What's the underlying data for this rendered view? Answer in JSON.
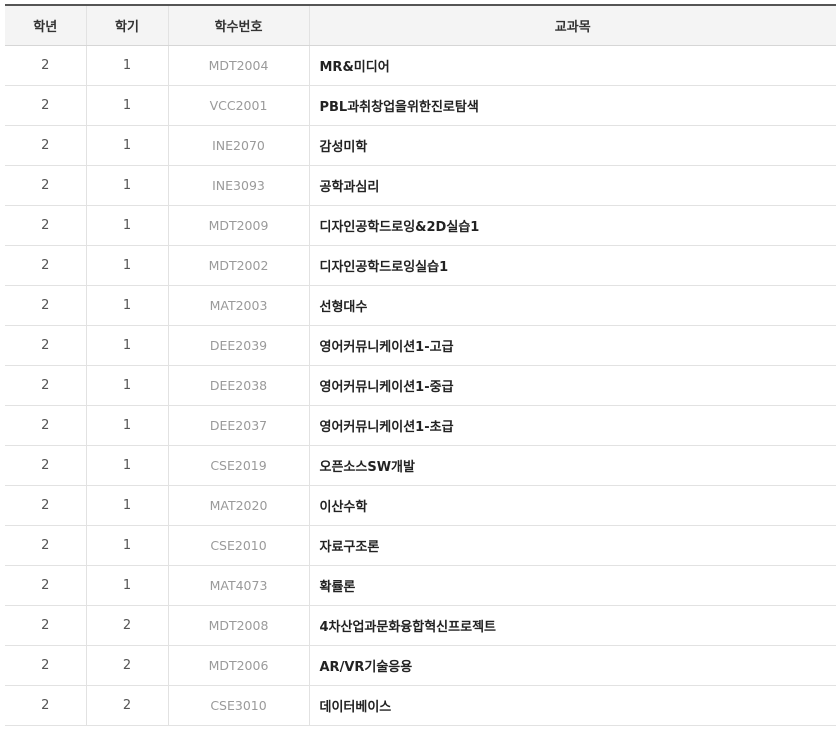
{
  "table": {
    "headers": [
      "학년",
      "학기",
      "학수번호",
      "교과목"
    ],
    "rows": [
      {
        "year": "2",
        "semester": "1",
        "code": "MDT2004",
        "course": "MR&미디어"
      },
      {
        "year": "2",
        "semester": "1",
        "code": "VCC2001",
        "course": "PBL과취창업을위한진로탐색"
      },
      {
        "year": "2",
        "semester": "1",
        "code": "INE2070",
        "course": "감성미학"
      },
      {
        "year": "2",
        "semester": "1",
        "code": "INE3093",
        "course": "공학과심리"
      },
      {
        "year": "2",
        "semester": "1",
        "code": "MDT2009",
        "course": "디자인공학드로잉&2D실습1"
      },
      {
        "year": "2",
        "semester": "1",
        "code": "MDT2002",
        "course": "디자인공학드로잉실습1"
      },
      {
        "year": "2",
        "semester": "1",
        "code": "MAT2003",
        "course": "선형대수"
      },
      {
        "year": "2",
        "semester": "1",
        "code": "DEE2039",
        "course": "영어커뮤니케이션1-고급"
      },
      {
        "year": "2",
        "semester": "1",
        "code": "DEE2038",
        "course": "영어커뮤니케이션1-중급"
      },
      {
        "year": "2",
        "semester": "1",
        "code": "DEE2037",
        "course": "영어커뮤니케이션1-초급"
      },
      {
        "year": "2",
        "semester": "1",
        "code": "CSE2019",
        "course": "오픈소스SW개발"
      },
      {
        "year": "2",
        "semester": "1",
        "code": "MAT2020",
        "course": "이산수학"
      },
      {
        "year": "2",
        "semester": "1",
        "code": "CSE2010",
        "course": "자료구조론"
      },
      {
        "year": "2",
        "semester": "1",
        "code": "MAT4073",
        "course": "확률론"
      },
      {
        "year": "2",
        "semester": "2",
        "code": "MDT2008",
        "course": "4차산업과문화융합혁신프로젝트"
      },
      {
        "year": "2",
        "semester": "2",
        "code": "MDT2006",
        "course": "AR/VR기술응용"
      },
      {
        "year": "2",
        "semester": "2",
        "code": "CSE3010",
        "course": "데이터베이스"
      }
    ]
  },
  "colors": {
    "header_bg": "#f4f4f4",
    "header_top_border": "#555555",
    "row_border": "#e2e2e2",
    "code_text": "#9a9a9a",
    "course_text": "#222222"
  }
}
